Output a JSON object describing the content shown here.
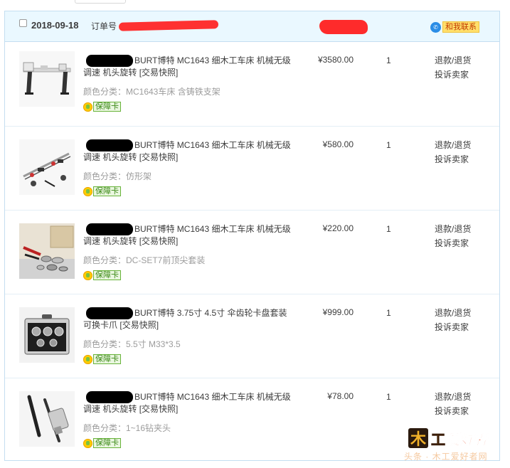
{
  "order": {
    "date": "2018-09-18",
    "order_number_label": "订单号",
    "contact_label": "和我联系",
    "contact_icon": "chat-bubble-icon"
  },
  "items": [
    {
      "title": "BURT博特 MC1643 细木工车床 机械无级调速 机头旋转",
      "snapshot": "[交易快照]",
      "variant": "颜色分类：MC1643车床 含铸铁支架",
      "badge": "保障卡",
      "price": "¥3580.00",
      "qty": "1",
      "action_refund": "退款/退货",
      "action_complain": "投诉卖家"
    },
    {
      "title": "BURT博特 MC1643 细木工车床 机械无级调速 机头旋转",
      "snapshot": "[交易快照]",
      "variant": "颜色分类：仿形架",
      "badge": "保障卡",
      "price": "¥580.00",
      "qty": "1",
      "action_refund": "退款/退货",
      "action_complain": "投诉卖家"
    },
    {
      "title": "BURT博特 MC1643 细木工车床 机械无级调速 机头旋转",
      "snapshot": "[交易快照]",
      "variant": "颜色分类：DC-SET7前顶尖套装",
      "badge": "保障卡",
      "price": "¥220.00",
      "qty": "1",
      "action_refund": "退款/退货",
      "action_complain": "投诉卖家"
    },
    {
      "title": "BURT博特 3.75寸 4.5寸 伞齿轮卡盘套装 可换卡爪",
      "snapshot": "[交易快照]",
      "variant": "颜色分类：5.5寸 M33*3.5",
      "badge": "保障卡",
      "price": "¥999.00",
      "qty": "1",
      "action_refund": "退款/退货",
      "action_complain": "投诉卖家"
    },
    {
      "title": "BURT博特 MC1643 细木工车床 机械无级调速 机头旋转",
      "snapshot": "[交易快照]",
      "variant": "颜色分类：1~16钻夹头",
      "badge": "保障卡",
      "price": "¥78.00",
      "qty": "1",
      "action_refund": "退款/退货",
      "action_complain": "投诉卖家"
    }
  ],
  "watermark": {
    "logo_text": "木工爱好者",
    "caption": "头条 · 木工爱好者网"
  },
  "colors": {
    "header_bg": "#eaf8ff",
    "border": "#c4def1",
    "badge_green": "#68b33a",
    "contact_yellow": "#ffdf6b",
    "redaction_red": "#ff2020"
  }
}
